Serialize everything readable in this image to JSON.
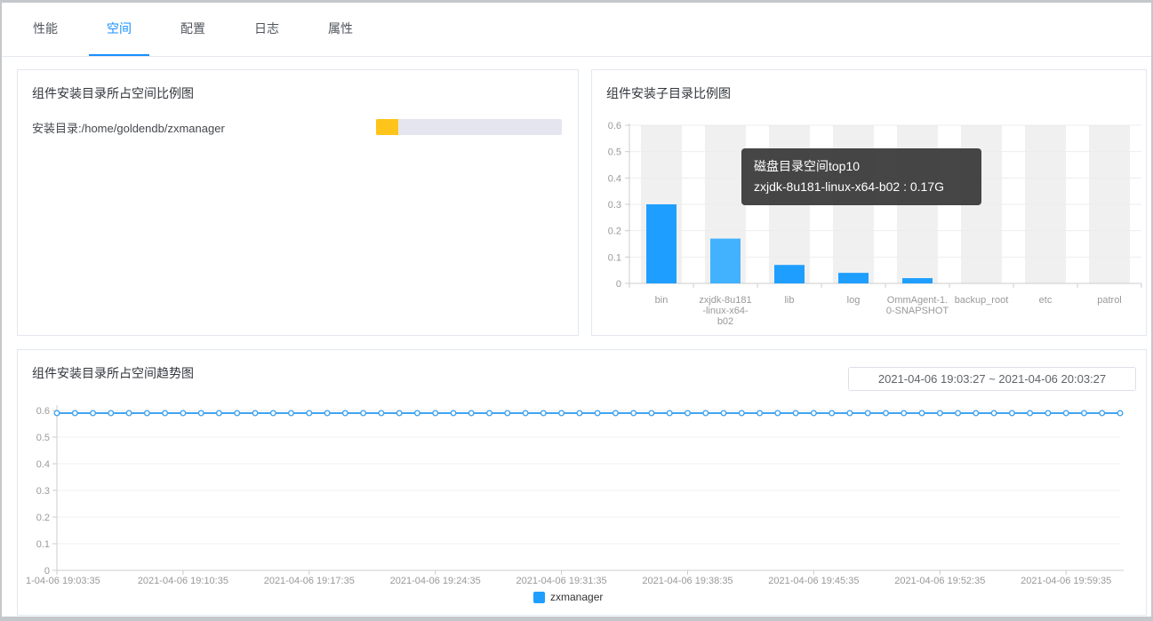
{
  "tabs": [
    {
      "label": "性能",
      "active": false
    },
    {
      "label": "空间",
      "active": true
    },
    {
      "label": "配置",
      "active": false
    },
    {
      "label": "日志",
      "active": false
    },
    {
      "label": "属性",
      "active": false
    }
  ],
  "left_panel": {
    "title": "组件安装目录所占空间比例图",
    "install_dir_label": "安装目录:/home/goldendb/zxmanager",
    "progress": {
      "percent": 12,
      "fill_color": "#ffc41a",
      "track_color": "#e5e5ef"
    }
  },
  "right_panel": {
    "title": "组件安装子目录比例图",
    "tooltip": {
      "title": "磁盘目录空间top10",
      "value_line": "zxjdk-8u181-linux-x64-b02 : 0.17G"
    },
    "chart_data": {
      "type": "bar",
      "title": "组件安装子目录比例图",
      "unit": "G",
      "categories": [
        "bin",
        "zxjdk-8u181-linux-x64-b02",
        "lib",
        "log",
        "OmmAgent-1.0-SNAPSHOT",
        "backup_root",
        "etc",
        "patrol"
      ],
      "category_label_lines": [
        [
          "bin"
        ],
        [
          "zxjdk-8u181",
          "-linux-x64-",
          "b02"
        ],
        [
          "lib"
        ],
        [
          "log"
        ],
        [
          "OmmAgent-1.",
          "0-SNAPSHOT"
        ],
        [
          "backup_root"
        ],
        [
          "etc"
        ],
        [
          "patrol"
        ]
      ],
      "values": [
        0.3,
        0.17,
        0.07,
        0.04,
        0.02,
        0,
        0,
        0
      ],
      "highlight_index": 1,
      "ylim": [
        0,
        0.6
      ],
      "yticks": [
        0,
        0.1,
        0.2,
        0.3,
        0.4,
        0.5,
        0.6
      ],
      "bar_color": "#1e9fff",
      "bar_highlight_color": "#42b2ff",
      "band_color": "#f0f0f0",
      "grid": true,
      "legend_position": "none"
    }
  },
  "bottom_panel": {
    "title": "组件安装目录所占空间趋势图",
    "date_range": "2021-04-06 19:03:27 ~ 2021-04-06 20:03:27",
    "legend": {
      "label": "zxmanager",
      "color": "#1e9fff"
    },
    "chart_data": {
      "type": "line",
      "x_tick_labels": [
        "1-04-06 19:03:35",
        "2021-04-06 19:10:35",
        "2021-04-06 19:17:35",
        "2021-04-06 19:24:35",
        "2021-04-06 19:31:35",
        "2021-04-06 19:38:35",
        "2021-04-06 19:45:35",
        "2021-04-06 19:52:35",
        "2021-04-06 19:59:35"
      ],
      "series": [
        {
          "name": "zxmanager",
          "values": [
            0.59,
            0.59,
            0.59,
            0.59,
            0.59,
            0.59,
            0.59,
            0.59,
            0.59,
            0.59,
            0.59,
            0.59,
            0.59,
            0.59,
            0.59,
            0.59,
            0.59,
            0.59,
            0.59,
            0.59,
            0.59,
            0.59,
            0.59,
            0.59,
            0.59,
            0.59,
            0.59,
            0.59,
            0.59,
            0.59,
            0.59,
            0.59,
            0.59,
            0.59,
            0.59,
            0.59,
            0.59,
            0.59,
            0.59,
            0.59,
            0.59,
            0.59,
            0.59,
            0.59,
            0.59,
            0.59,
            0.59,
            0.59,
            0.59,
            0.59,
            0.59,
            0.59,
            0.59,
            0.59,
            0.59,
            0.59,
            0.59,
            0.59,
            0.59,
            0.59
          ]
        }
      ],
      "ylim": [
        0,
        0.6
      ],
      "yticks": [
        0,
        0.1,
        0.2,
        0.3,
        0.4,
        0.5,
        0.6
      ],
      "line_color": "#42a4f0",
      "marker": "hollow-circle",
      "grid": true,
      "legend_position": "bottom-center"
    }
  },
  "colors": {
    "accent": "#1890ff",
    "panel_border": "#e3e7ee",
    "axis_line": "#cccccc",
    "axis_label": "#999999",
    "grid_line": "#ededed",
    "frame": "#c4c7cb"
  }
}
